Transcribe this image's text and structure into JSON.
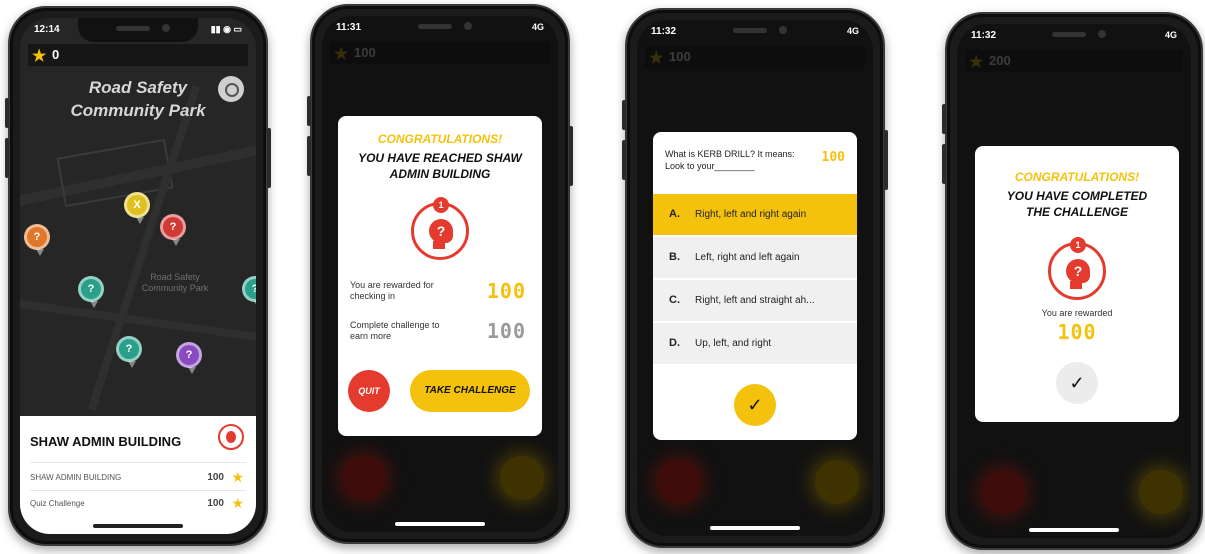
{
  "phone1": {
    "time": "12:14",
    "stars": "0",
    "park_title_line1": "Road Safety",
    "park_title_line2": "Community Park",
    "map_label": "Road Safety Community Park",
    "card_title": "SHAW ADMIN BUILDING",
    "rows": [
      {
        "label": "SHAW ADMIN BUILDING",
        "points": "100"
      },
      {
        "label": "Quiz Challenge",
        "points": "100"
      }
    ],
    "pin_colors": [
      "#e0782b",
      "#e0c020",
      "#d03a36",
      "#2aa08a",
      "#2aa08a",
      "#2aa08a",
      "#8a4ac0"
    ]
  },
  "phone2": {
    "time": "11:31",
    "stars": "100",
    "network": "4G",
    "congrats": "CONGRATULATIONS!",
    "headline_line1": "YOU HAVE REACHED SHAW",
    "headline_line2": "ADMIN BUILDING",
    "badge_number": "1",
    "reward_label": "You are rewarded for checking in",
    "reward_points": "100",
    "complete_label": "Complete challenge to earn more",
    "complete_points": "100",
    "quit_label": "QUIT",
    "take_label": "TAKE CHALLENGE"
  },
  "phone3": {
    "time": "11:32",
    "stars": "100",
    "network": "4G",
    "question": "What is KERB DRILL? It means: Look to your________",
    "points": "100",
    "options": [
      {
        "letter": "A.",
        "text": "Right, left and right again",
        "selected": true
      },
      {
        "letter": "B.",
        "text": "Left, right and left again",
        "selected": false
      },
      {
        "letter": "C.",
        "text": "Right, left and straight ah...",
        "selected": false
      },
      {
        "letter": "D.",
        "text": "Up, left, and right",
        "selected": false
      }
    ],
    "submit_icon": "check-icon"
  },
  "phone4": {
    "time": "11:32",
    "stars": "200",
    "network": "4G",
    "congrats": "CONGRATULATIONS!",
    "headline_line1": "YOU HAVE COMPLETED",
    "headline_line2": "THE CHALLENGE",
    "badge_number": "1",
    "reward_label": "You are rewarded",
    "reward_points": "100"
  },
  "colors": {
    "accent": "#f4c20d",
    "red": "#e53b2f",
    "dark": "#262626"
  }
}
